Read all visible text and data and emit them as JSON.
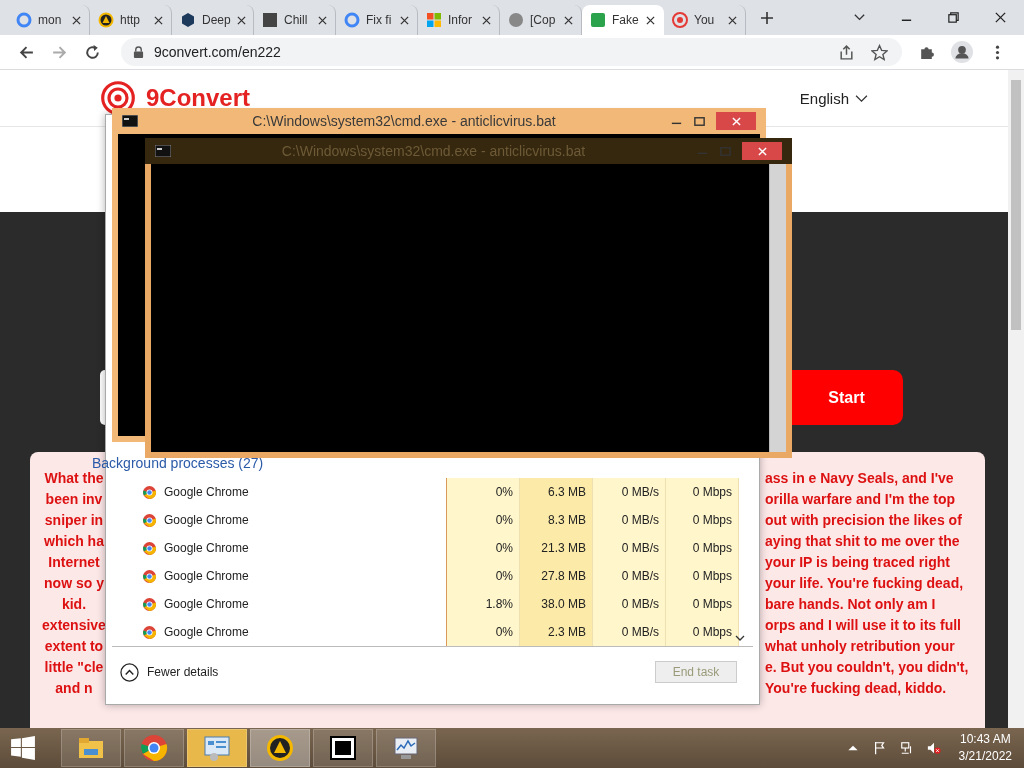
{
  "browser": {
    "tabs": [
      {
        "label": "mon",
        "selected": false
      },
      {
        "label": "http",
        "selected": false
      },
      {
        "label": "Deep",
        "selected": false
      },
      {
        "label": "Chill",
        "selected": false
      },
      {
        "label": "Fix fi",
        "selected": false
      },
      {
        "label": "Infor",
        "selected": false
      },
      {
        "label": "[Cop",
        "selected": false
      },
      {
        "label": "Fake",
        "selected": true
      },
      {
        "label": "You",
        "selected": false
      }
    ],
    "address": "9convert.com/en222"
  },
  "page": {
    "logo": "9Convert",
    "language": "English",
    "start_button": "Start",
    "message_left": [
      "What the",
      "been inv",
      "sniper in",
      "which ha",
      "Internet",
      "now so y",
      "kid.",
      "extensive",
      "extent to",
      "little \"cle",
      "and n"
    ],
    "message_right": [
      "ass in e Navy Seals, and I've",
      "orilla warfare and I'm the top",
      "out with precision the likes of",
      "aying that shit to me over the",
      "your IP is being traced right",
      "your life. You're fucking dead,",
      "bare hands. Not only am I",
      "orps and I will use it to its full",
      "what unholy retribution your",
      "e. But you couldn't, you didn't,",
      "You're fucking dead, kiddo."
    ]
  },
  "task_manager": {
    "section": "Background processes (27)",
    "rows": [
      {
        "name": "Google Chrome",
        "cpu": "0%",
        "memory": "6.3 MB",
        "disk": "0 MB/s",
        "network": "0 Mbps"
      },
      {
        "name": "Google Chrome",
        "cpu": "0%",
        "memory": "8.3 MB",
        "disk": "0 MB/s",
        "network": "0 Mbps"
      },
      {
        "name": "Google Chrome",
        "cpu": "0%",
        "memory": "21.3 MB",
        "disk": "0 MB/s",
        "network": "0 Mbps"
      },
      {
        "name": "Google Chrome",
        "cpu": "0%",
        "memory": "27.8 MB",
        "disk": "0 MB/s",
        "network": "0 Mbps"
      },
      {
        "name": "Google Chrome",
        "cpu": "1.8%",
        "memory": "38.0 MB",
        "disk": "0 MB/s",
        "network": "0 Mbps"
      },
      {
        "name": "Google Chrome",
        "cpu": "0%",
        "memory": "2.3 MB",
        "disk": "0 MB/s",
        "network": "0 Mbps"
      }
    ],
    "fewer_details": "Fewer details",
    "end_task": {
      "label": "End task",
      "disabled": true
    }
  },
  "cmd_windows": [
    {
      "title": "C:\\Windows\\system32\\cmd.exe - anticlicvirus.bat"
    },
    {
      "title": "C:\\Windows\\system32\\cmd.exe - anticlicvirus.bat"
    }
  ],
  "taskbar": {
    "time": "10:43 AM",
    "date": "3/21/2022"
  }
}
